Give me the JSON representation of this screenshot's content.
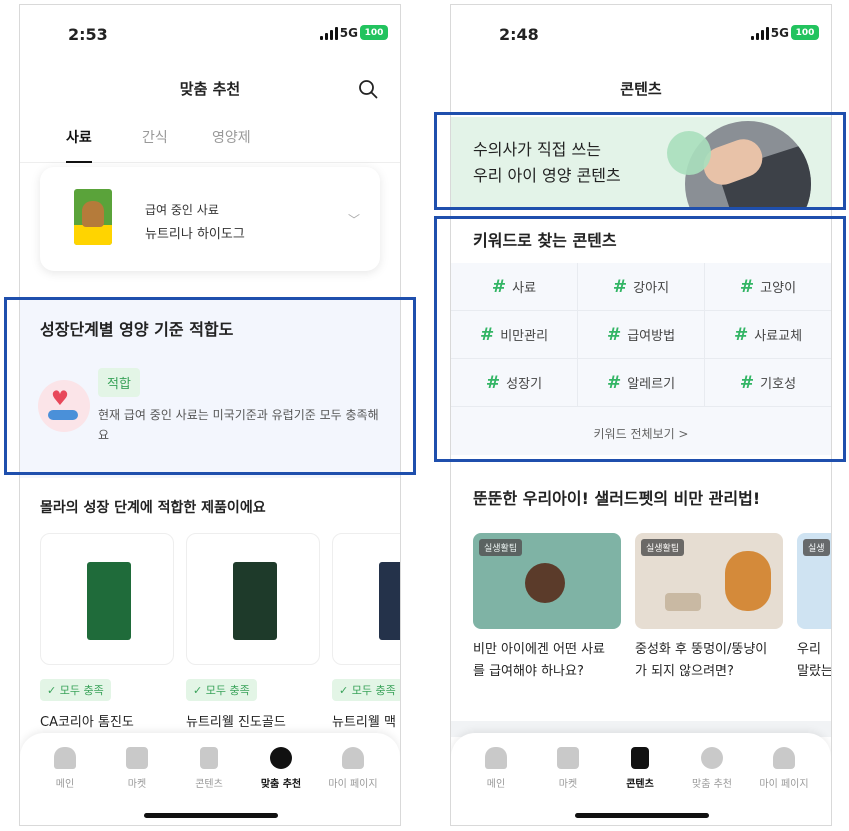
{
  "left": {
    "status": {
      "time": "2:53",
      "network": "5G",
      "battery": "100"
    },
    "header": {
      "title": "맞춤 추천"
    },
    "tabs": [
      {
        "label": "사료"
      },
      {
        "label": "간식"
      },
      {
        "label": "영양제"
      }
    ],
    "current_food": {
      "label": "급여 중인 사료",
      "name": "뉴트리나 하이도그"
    },
    "growth": {
      "title": "성장단계별 영양 기준 적합도",
      "badge": "적합",
      "desc": "현재 급여 중인 사료는 미국기준과 유럽기준 모두 충족해요"
    },
    "recommend": {
      "title": "몰라의 성장 단계에 적합한 제품이에요",
      "products": [
        {
          "badge": "모두 충족",
          "name": "CA코리아 톰진도",
          "color": "#1f6b3a"
        },
        {
          "badge": "모두 충족",
          "name": "뉴트리웰 진도골드",
          "color": "#1e3a2a"
        },
        {
          "badge": "모두 충족",
          "name": "뉴트리웰 맥",
          "color": "#24324a"
        }
      ]
    },
    "nav": [
      {
        "label": "메인"
      },
      {
        "label": "마켓"
      },
      {
        "label": "콘텐츠"
      },
      {
        "label": "맞춤 추천"
      },
      {
        "label": "마이 페이지"
      }
    ]
  },
  "right": {
    "status": {
      "time": "2:48",
      "network": "5G",
      "battery": "100"
    },
    "header": {
      "title": "콘텐츠"
    },
    "banner": {
      "line1": "수의사가 직접 쓰는",
      "line2": "우리 아이 영양 콘텐츠"
    },
    "keywords": {
      "title": "키워드로 찾는 콘텐츠",
      "items": [
        "사료",
        "강아지",
        "고양이",
        "비만관리",
        "급여방법",
        "사료교체",
        "성장기",
        "알레르기",
        "기호성"
      ],
      "see_all": "키워드 전체보기 >"
    },
    "article_section": {
      "title": "뚠뚠한 우리아이! 샐러드펫의 비만 관리법!",
      "cards": [
        {
          "tag": "실생활팁",
          "line1": "비만 아이에겐 어떤 사료",
          "line2": "를 급여해야 하나요?"
        },
        {
          "tag": "실생활팁",
          "line1": "중성화 후 뚱멍이/뚱냥이",
          "line2": "가 되지 않으려면?"
        },
        {
          "tag": "실생",
          "line1": "우리 ",
          "line2": "말랐는"
        }
      ]
    },
    "nav": [
      {
        "label": "메인"
      },
      {
        "label": "마켓"
      },
      {
        "label": "콘텐츠"
      },
      {
        "label": "맞춤 추천"
      },
      {
        "label": "마이 페이지"
      }
    ]
  },
  "colors": {
    "accent_green": "#33b565",
    "highlight_blue": "#1f4fad"
  }
}
